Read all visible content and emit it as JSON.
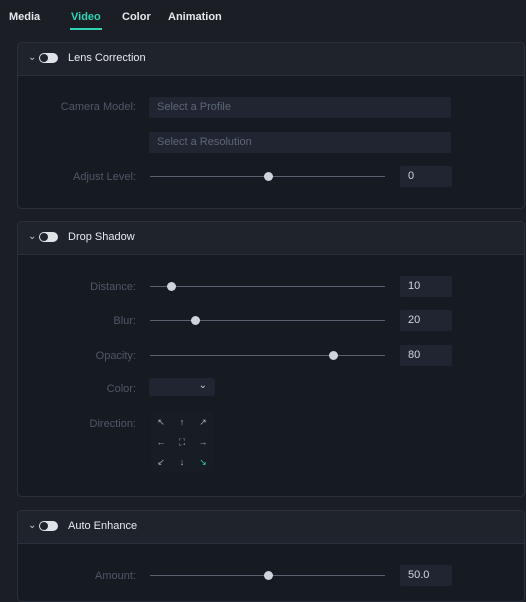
{
  "tabs": [
    {
      "label": "Media"
    },
    {
      "label": "Video"
    },
    {
      "label": "Color"
    },
    {
      "label": "Animation"
    }
  ],
  "active_tab": "Video",
  "lens_correction": {
    "title": "Lens Correction",
    "enabled": true,
    "camera_model_label": "Camera Model:",
    "profile_placeholder": "Select a Profile",
    "resolution_placeholder": "Select a Resolution",
    "adjust_level_label": "Adjust Level:",
    "adjust_level_value": "0",
    "adjust_level_fraction": 0.5
  },
  "drop_shadow": {
    "title": "Drop Shadow",
    "enabled": true,
    "distance_label": "Distance:",
    "distance_value": "10",
    "distance_fraction": 0.09,
    "blur_label": "Blur:",
    "blur_value": "20",
    "blur_fraction": 0.19,
    "opacity_label": "Opacity:",
    "opacity_value": "80",
    "opacity_fraction": 0.78,
    "color_label": "Color:",
    "direction_label": "Direction:",
    "directions": {
      "nw": "↖",
      "n": "↑",
      "ne": "↗",
      "w": "←",
      "c": "⛶",
      "e": "→",
      "sw": "↙",
      "s": "↓",
      "se": "↘"
    },
    "selected_direction": "se"
  },
  "auto_enhance": {
    "title": "Auto Enhance",
    "enabled": true,
    "amount_label": "Amount:",
    "amount_value": "50.0",
    "amount_fraction": 0.5
  },
  "icons": {
    "collapse": "chevron-down-icon",
    "dropdown": "chevron-down-icon",
    "toggle": "toggle-switch"
  },
  "colors": {
    "accent": "#2fd5b4",
    "background": "#1b1e25",
    "panel": "#161a21",
    "field": "#202531"
  }
}
